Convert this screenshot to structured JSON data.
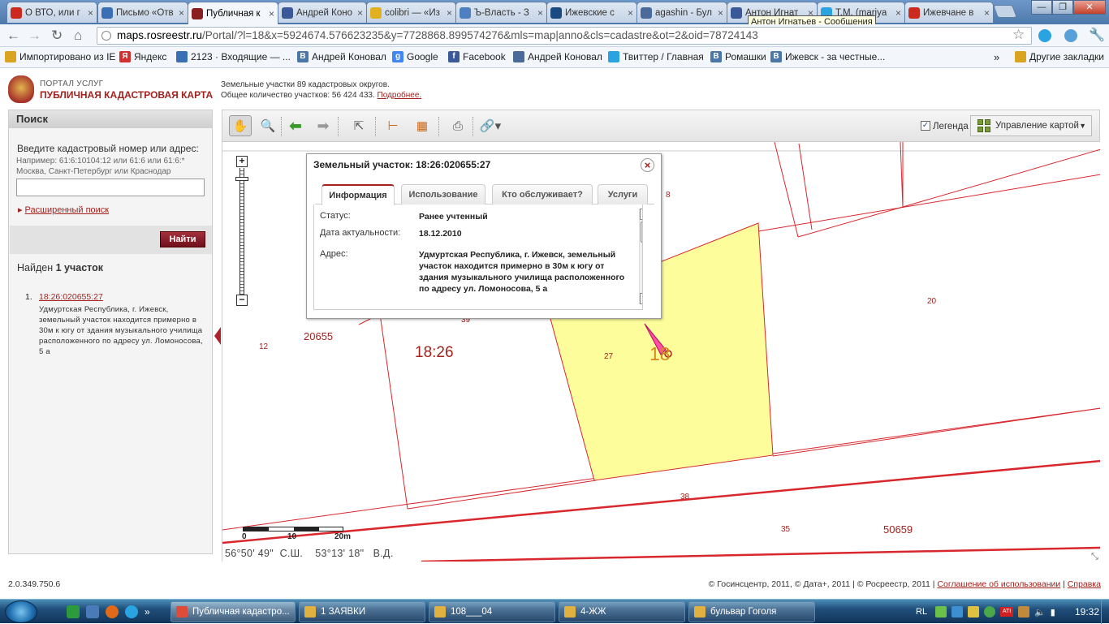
{
  "browser": {
    "tabs": [
      {
        "title": "О ВТО, или г",
        "icon_color": "#cc2a1e",
        "icon": "forbidden-icon"
      },
      {
        "title": "Письмо «Отв",
        "icon_color": "#3a6fb5",
        "icon": "mail-icon"
      },
      {
        "title": "Публичная к",
        "icon_color": "#8a1f1f",
        "icon": "globe-icon",
        "active": true
      },
      {
        "title": "Андрей Коно",
        "icon_color": "#3b5998",
        "icon": "person-icon"
      },
      {
        "title": "colibri — «Из",
        "icon_color": "#e0b020",
        "icon": "arrow-icon"
      },
      {
        "title": "Ъ-Власть - З",
        "icon_color": "#4f7fbf",
        "icon": "ie-icon"
      },
      {
        "title": "Ижевские с",
        "icon_color": "#1c4a80",
        "icon": "mail-icon"
      },
      {
        "title": "agashin - Бул",
        "icon_color": "#4a6a9a",
        "icon": "person-icon"
      },
      {
        "title": "Антон Игнат",
        "icon_color": "#3b5998",
        "icon": "facebook-icon"
      },
      {
        "title": "T.M. (mariya",
        "icon_color": "#2aa4e0",
        "icon": "twitter-icon"
      },
      {
        "title": "Ижевчане в",
        "icon_color": "#cc2a1e",
        "icon": "d-icon"
      }
    ],
    "tooltip": "Антон Игнатьев - Сообщения",
    "url_host": "maps.rosreestr.ru",
    "url_path": "/Portal/?l=18&x=5924674.576623235&y=7728868.899574276&mls=map|anno&cls=cadastre&ot=2&oid=78724143",
    "bookmarks": [
      {
        "label": "Импортировано из IE",
        "icon_color": "#d9a520",
        "icon": "folder-icon"
      },
      {
        "label": "Яндекс",
        "icon_color": "#d32f2f",
        "icon": "yandex-icon",
        "glyph": "Я"
      },
      {
        "label": "2123 · Входящие — ...",
        "icon_color": "#3a6fb5",
        "icon": "mail-icon"
      },
      {
        "label": "Андрей Коновал",
        "icon_color": "#4a76a8",
        "icon": "vk-icon",
        "glyph": "B"
      },
      {
        "label": "Google",
        "icon_color": "#4285f4",
        "icon": "google-icon",
        "glyph": "g"
      },
      {
        "label": "Facebook",
        "icon_color": "#3b5998",
        "icon": "facebook-icon",
        "glyph": "f"
      },
      {
        "label": "Андрей Коновал",
        "icon_color": "#4a6a9a",
        "icon": "person-icon"
      },
      {
        "label": "Твиттер / Главная",
        "icon_color": "#2aa4e0",
        "icon": "twitter-icon"
      },
      {
        "label": "Ромашки",
        "icon_color": "#4a76a8",
        "icon": "vk-icon",
        "glyph": "B"
      },
      {
        "label": "Ижевск - за честные...",
        "icon_color": "#4a76a8",
        "icon": "vk-icon",
        "glyph": "B"
      }
    ],
    "bookmarks_more": "»",
    "other_bookmarks": "Другие закладки"
  },
  "portal": {
    "label": "ПОРТАЛ УСЛУГ",
    "title": "ПУБЛИЧНАЯ КАДАСТРОВАЯ КАРТА",
    "stats_line1": "Земельные участки 89 кадастровых округов.",
    "stats_line2": "Общее количество участков: 56 424 433.",
    "stats_more": "Подробнее."
  },
  "search": {
    "header": "Поиск",
    "prompt": "Введите кадастровый номер или адрес:",
    "example": "Например: 61:6:10104:12 или 61:6 или 61:6:* Москва, Санкт-Петербург или Краснодар",
    "value": "",
    "advanced": "Расширенный поиск",
    "button": "Найти",
    "found_prefix": "Найден",
    "found_count": "1 участок"
  },
  "results": [
    {
      "num": "1.",
      "number": "18:26:020655:27",
      "address": "Удмуртская Республика, г. Ижевск, земельный участок находится примерно в 30м к югу от здания музыкального училища расположенного по адресу ул. Ломоносова, 5 а"
    }
  ],
  "toolbar": {
    "legend_checked": true,
    "legend_label": "Легенда",
    "map_control": "Управление картой"
  },
  "map": {
    "labels": {
      "block1": "20655",
      "quarter": "18:26",
      "n12": "12",
      "n39": "39",
      "n27": "27",
      "n18": "18",
      "n20": "20",
      "n8": "8",
      "n38": "38",
      "n35": "35",
      "block2": "50659"
    },
    "scale_0": "0",
    "scale_10": "10",
    "scale_20": "20m",
    "lat": "56°50' 49\"",
    "lat_hem": "С.Ш.",
    "lon": "53°13' 18\"",
    "lon_hem": "В.Д.",
    "colors": {
      "parcel_fill": "#fdfd9c",
      "boundary": "#d9272e",
      "label": "#a3221e"
    }
  },
  "popup": {
    "title": "Земельный участок: 18:26:020655:27",
    "tabs": [
      "Информация",
      "Использование",
      "Кто обслуживает?",
      "Услуги"
    ],
    "rows": [
      {
        "label": "Статус:",
        "value": "Ранее учтенный"
      },
      {
        "label": "Дата актуальности:",
        "value": "18.12.2010"
      },
      {
        "label": "Адрес:",
        "value": "Удмуртская Республика, г. Ижевск, земельный участок находится примерно в 30м к югу от здания музыкального училища расположенного по адресу ул. Ломоносова, 5 а"
      }
    ]
  },
  "footer": {
    "version": "2.0.349.750.6",
    "copyright": "© Госинсцентр, 2011, © Дата+, 2011 | © Росреестр, 2011 |",
    "terms": "Соглашение об использовании",
    "help": "Справка"
  },
  "taskbar": {
    "tasks": [
      {
        "label": "Публичная кадастро...",
        "icon_color": "#dd4b39",
        "icon": "chrome-icon"
      },
      {
        "label": "1 ЗАЯВКИ",
        "icon_color": "#e0b040",
        "icon": "folder-icon"
      },
      {
        "label": "108___04",
        "icon_color": "#e0b040",
        "icon": "folder-icon"
      },
      {
        "label": "4-ЖЖ",
        "icon_color": "#e0b040",
        "icon": "folder-icon"
      },
      {
        "label": "бульвар Гоголя",
        "icon_color": "#e0b040",
        "icon": "folder-icon"
      }
    ],
    "lang": "RL",
    "time": "19:32"
  }
}
